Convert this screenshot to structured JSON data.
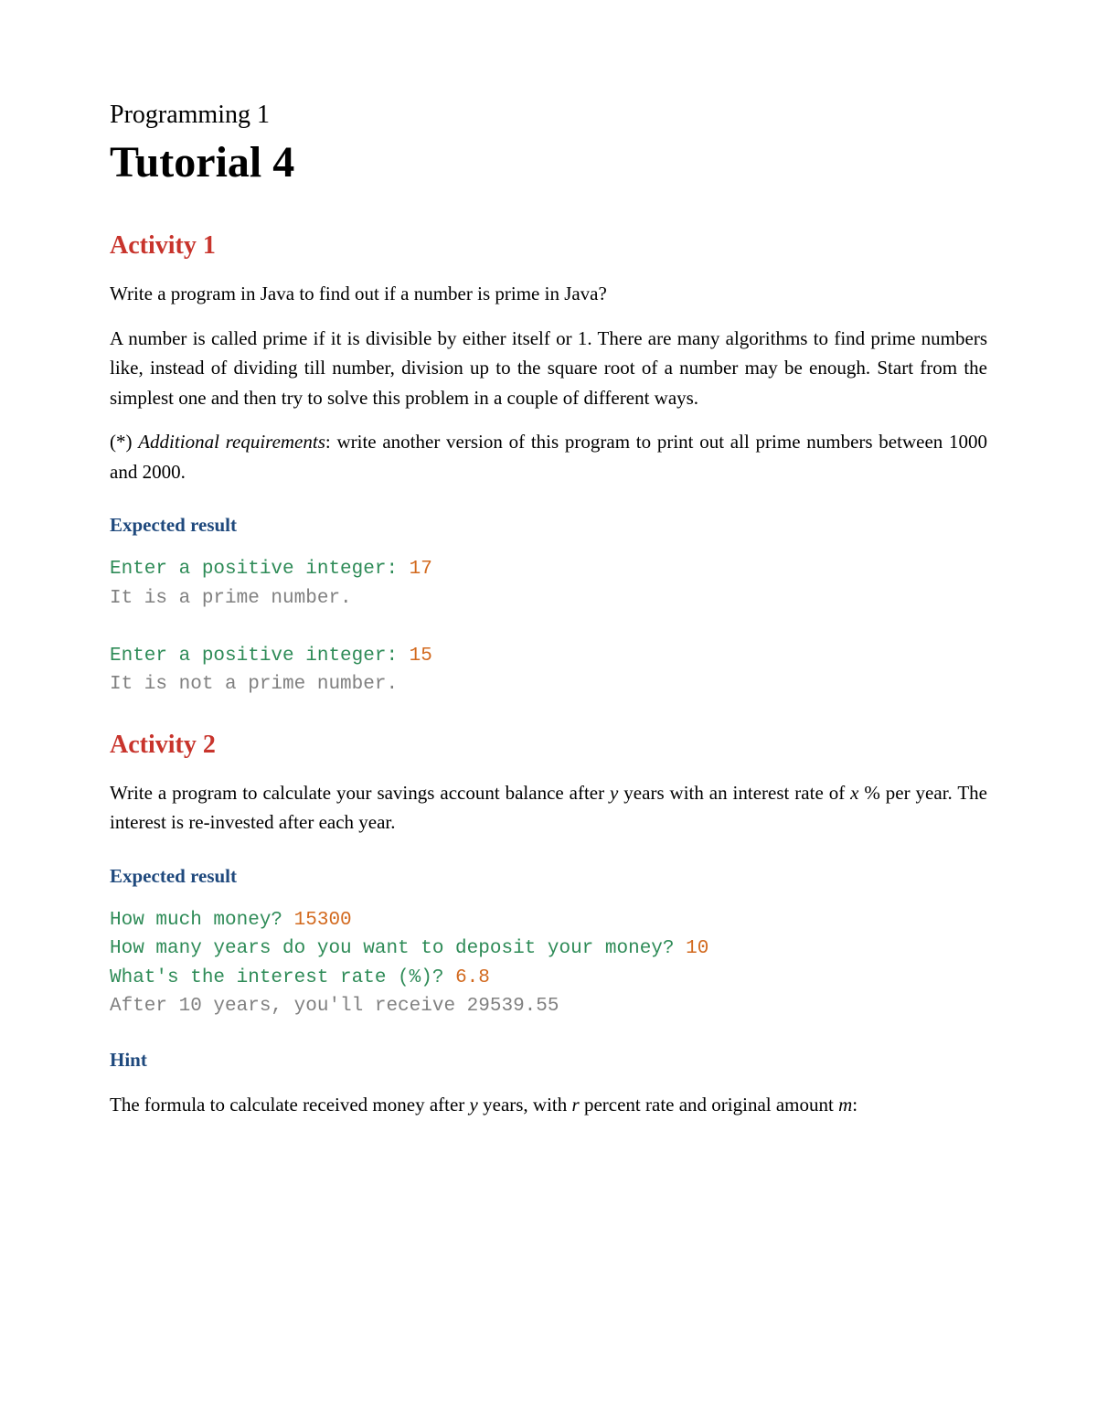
{
  "header": {
    "course": "Programming 1",
    "title": "Tutorial 4"
  },
  "activity1": {
    "heading": "Activity 1",
    "p1": "Write a program in Java to find out if a number is prime in Java?",
    "p2": "A number is called prime if it is divisible by either itself or 1. There are many algorithms to find prime numbers like, instead of dividing till number, division up to the square root of a number may be enough. Start from the simplest one and then try to solve this problem in a couple of different ways.",
    "p3_prefix": "(*) ",
    "p3_italic": "Additional requirements",
    "p3_rest": ": write another version of this program to print out all prime numbers between 1000 and 2000.",
    "expected_label": "Expected result",
    "code": {
      "l1_prompt": "Enter a positive integer: ",
      "l1_input": "17",
      "l2_output": "It is a prime number.",
      "l3_blank": " ",
      "l4_prompt": "Enter a positive integer: ",
      "l4_input": "15",
      "l5_output": "It is not a prime number."
    }
  },
  "activity2": {
    "heading": "Activity 2",
    "p1_a": "Write a program to calculate your savings account balance after ",
    "p1_y": "y",
    "p1_b": " years with an interest rate of ",
    "p1_x": "x",
    "p1_c": " % per year. The interest is re-invested after each year.",
    "expected_label": "Expected result",
    "code": {
      "l1_prompt": "How much money? ",
      "l1_input": "15300",
      "l2_prompt": "How many years do you want to deposit your money? ",
      "l2_input": "10",
      "l3_prompt": "What's the interest rate (%)? ",
      "l3_input": "6.8",
      "l4_output": "After 10 years, you'll receive 29539.55"
    },
    "hint_label": "Hint",
    "hint_a": "The formula to calculate received money after ",
    "hint_y": "y",
    "hint_b": " years, with ",
    "hint_r": "r",
    "hint_c": " percent rate and original amount ",
    "hint_m": "m",
    "hint_d": ":"
  }
}
